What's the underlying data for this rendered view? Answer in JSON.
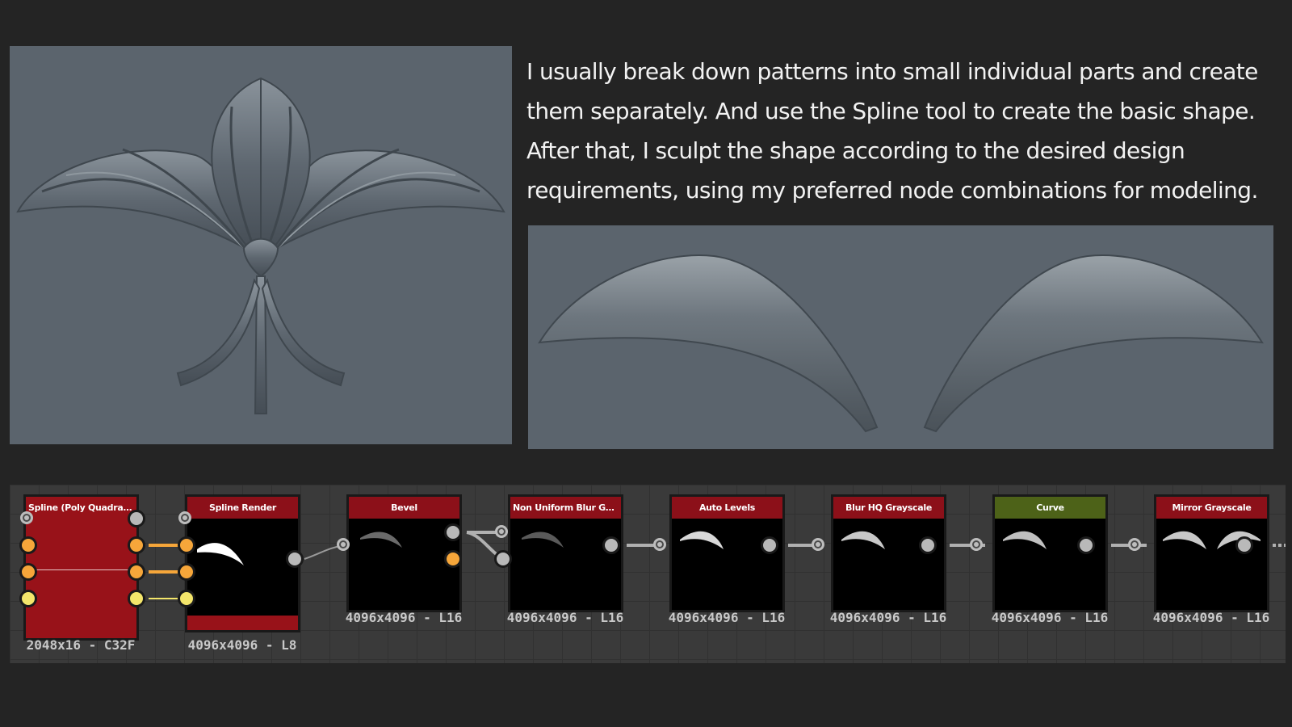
{
  "description": {
    "text": "I usually break down patterns into small individual parts and create them separately. And use the Spline tool to create the basic shape. After that, I sculpt the shape according to the desired design requirements, using my preferred node combinations for modeling."
  },
  "nodes": [
    {
      "title": "Spline (Poly Quadratic)",
      "size": "2048x16 - C32F",
      "title_color": "#981219"
    },
    {
      "title": "Spline Render",
      "size": "4096x4096 - L8",
      "title_color": "#8c1019"
    },
    {
      "title": "Bevel",
      "size": "4096x4096 - L16",
      "title_color": "#8c1019"
    },
    {
      "title": "Non Uniform Blur Gray...",
      "size": "4096x4096 - L16",
      "title_color": "#8c1019"
    },
    {
      "title": "Auto Levels",
      "size": "4096x4096 - L16",
      "title_color": "#8c1019"
    },
    {
      "title": "Blur HQ Grayscale",
      "size": "4096x4096 - L16",
      "title_color": "#8c1019"
    },
    {
      "title": "Curve",
      "size": "4096x4096 - L16",
      "title_color": "#4d6218"
    },
    {
      "title": "Mirror Grayscale",
      "size": "4096x4096 - L16",
      "title_color": "#8c1019"
    }
  ],
  "colors": {
    "background": "#242424",
    "viewport": "#5b646d",
    "graph_background": "#3a3a3a",
    "node_title_red": "#8c1019",
    "node_title_green": "#4d6218",
    "port_orange": "#f6a63a",
    "port_yellow": "#f4e66b",
    "port_gray": "#b9b9b9"
  }
}
